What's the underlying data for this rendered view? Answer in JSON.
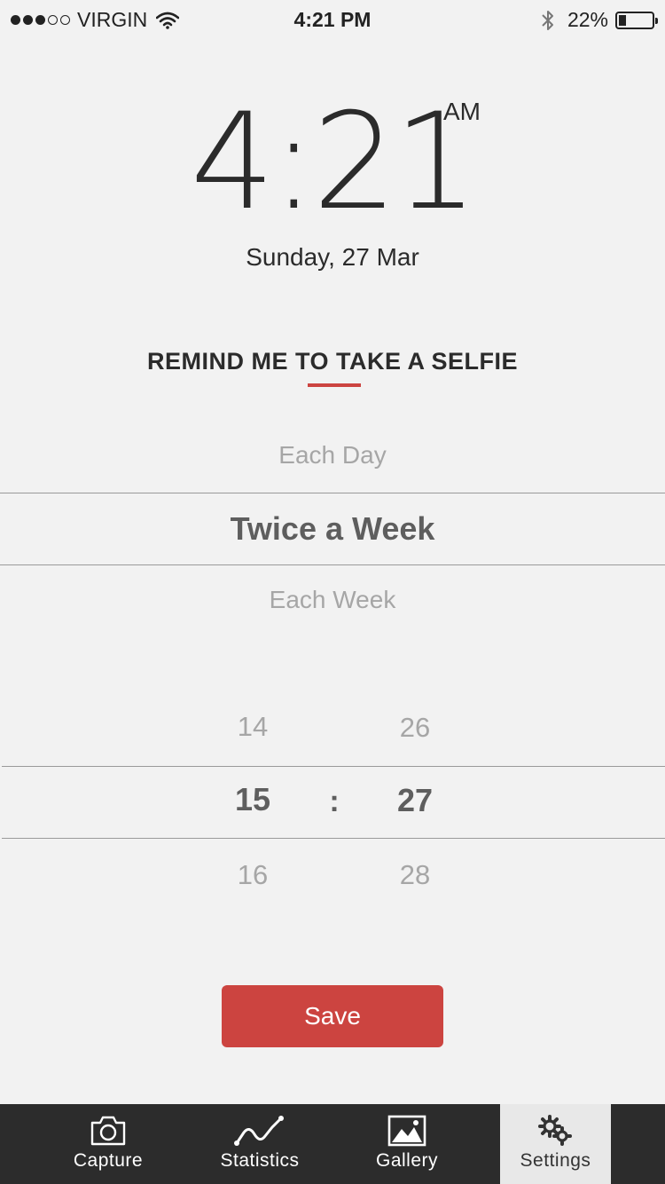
{
  "status_bar": {
    "carrier": "VIRGIN",
    "time": "4:21 PM",
    "battery_percent": "22%",
    "battery_level": 0.22,
    "signal_bars_filled": 3,
    "signal_bars_total": 5
  },
  "clock": {
    "time": "4:21",
    "ampm": "AM",
    "date": "Sunday, 27 Mar"
  },
  "reminder": {
    "title": "REMIND ME TO TAKE A SELFIE",
    "frequency_options": {
      "above": "Each Day",
      "selected": "Twice a Week",
      "below": "Each Week"
    },
    "time_picker": {
      "hour_above": "14",
      "hour_selected": "15",
      "hour_below": "16",
      "separator": ":",
      "minute_above": "26",
      "minute_selected": "27",
      "minute_below": "28"
    },
    "save_label": "Save"
  },
  "tab_bar": {
    "active": "Settings",
    "tabs": [
      {
        "label": "Capture",
        "icon": "camera-icon"
      },
      {
        "label": "Statistics",
        "icon": "line-chart-icon"
      },
      {
        "label": "Gallery",
        "icon": "image-icon"
      },
      {
        "label": "Settings",
        "icon": "gears-icon"
      }
    ]
  },
  "colors": {
    "accent": "#cc4440",
    "background": "#f2f2f2",
    "tab_bar": "#2c2c2c",
    "active_tab": "#e8e8e8"
  }
}
